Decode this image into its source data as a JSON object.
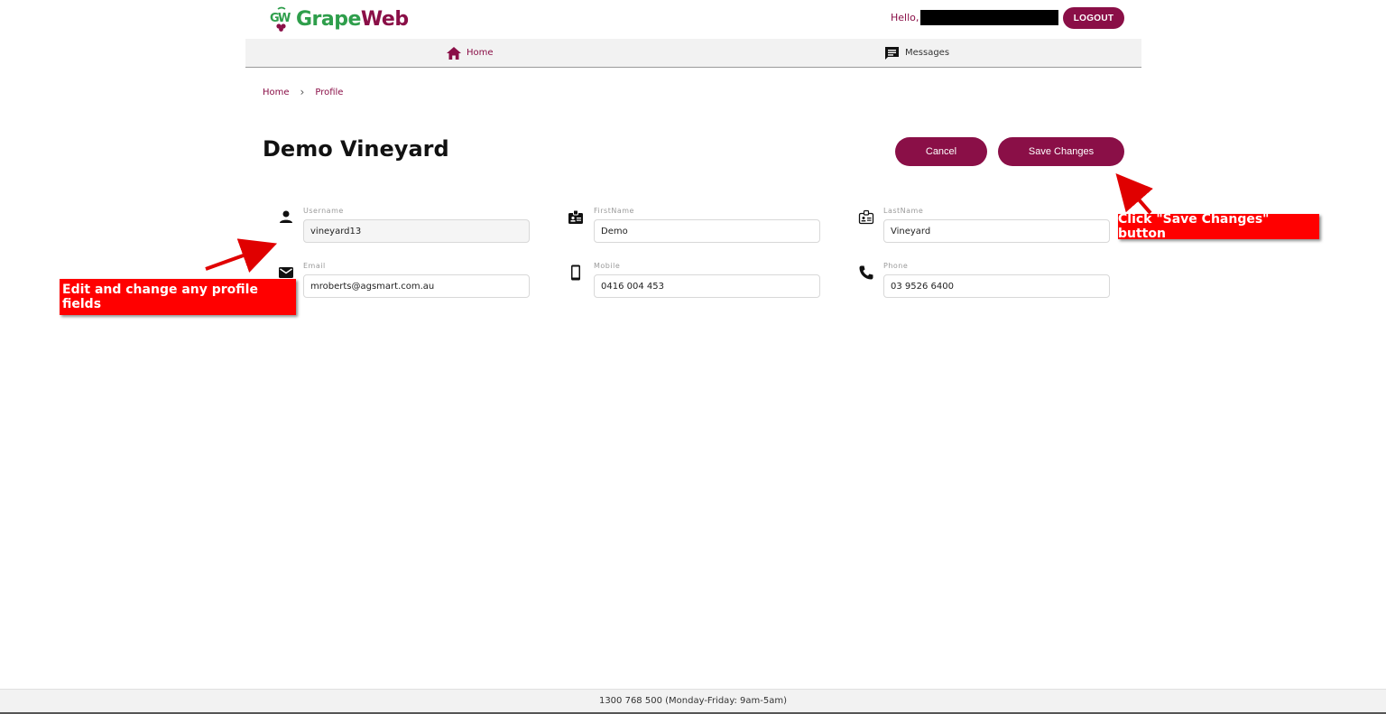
{
  "header": {
    "brand_part1": "Grape",
    "brand_part2": "Web",
    "greeting": "Hello,",
    "logout_label": "LOGOUT"
  },
  "nav": {
    "home_label": "Home",
    "messages_label": "Messages"
  },
  "breadcrumb": {
    "home": "Home",
    "separator": "›",
    "current": "Profile"
  },
  "page": {
    "title": "Demo Vineyard",
    "cancel_label": "Cancel",
    "save_label": "Save Changes"
  },
  "fields": {
    "username": {
      "label": "Username",
      "value": "vineyard13",
      "icon": "person-icon"
    },
    "firstname": {
      "label": "FirstName",
      "value": "Demo",
      "icon": "badge-icon"
    },
    "lastname": {
      "label": "LastName",
      "value": "Vineyard",
      "icon": "badge-outline-icon"
    },
    "email": {
      "label": "Email",
      "value": "mroberts@agsmart.com.au",
      "icon": "mail-icon"
    },
    "mobile": {
      "label": "Mobile",
      "value": "0416 004 453",
      "icon": "mobile-icon"
    },
    "phone": {
      "label": "Phone",
      "value": "03 9526 6400",
      "icon": "phone-icon"
    }
  },
  "annotations": {
    "save_hint": "Click \"Save Changes\" button",
    "edit_hint": "Edit and change any profile fields"
  },
  "footer": {
    "text": "1300 768 500 (Monday-Friday: 9am-5am)"
  },
  "colors": {
    "brand": "#8a0f47",
    "brand_green": "#2e9e4b",
    "annotation_red": "#ff0000"
  }
}
